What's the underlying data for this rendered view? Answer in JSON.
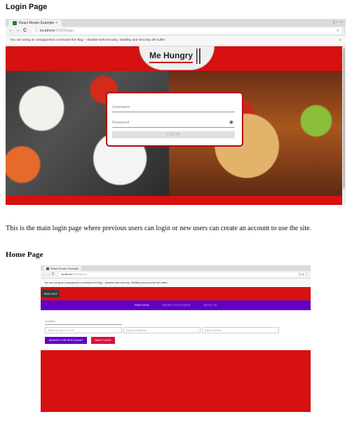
{
  "section1": {
    "heading": "Login Page",
    "description": "This is the main login page where previous users can login or new users can create an account to use the site."
  },
  "section2": {
    "heading": "Home Page"
  },
  "shot1": {
    "tab_title": "React Router Example",
    "tab_close": "×",
    "url_host": "localhost",
    "url_path": ":5000/login",
    "nav_back": "←",
    "nav_forward": "→",
    "nav_reload": "C",
    "lock_glyph": "ⓘ",
    "star_glyph": "☆",
    "menu_glyph": "⋮",
    "window_controls": "▯ – ▫ ×",
    "infobar_message": "You are using an unsupported command-line flag: --disable-web-security. Stability and security will suffer.",
    "infobar_close": "×",
    "logo_text": "Me Hungry",
    "username_placeholder": "Username",
    "password_placeholder": "Password",
    "eye_glyph": "◉",
    "login_button": "LOG IN",
    "colors": {
      "brand_red": "#d71010",
      "card_border": "#b40c0c"
    }
  },
  "shot2": {
    "tab_title": "React Router Example",
    "url_host": "localhost",
    "url_path": ":3000/home",
    "nav_glyphs": "← → C",
    "toolbar_glyphs": "☆ ◐ ⋮",
    "infobar_message": "You are using an unsupported command-line flag: --disable-web-security. Stability and security will suffer.",
    "sign_out": "SIGN OUT",
    "nav_tabs": [
      {
        "label": "FIND FOOD",
        "active": true
      },
      {
        "label": "WHERE YOU'VE BEEN",
        "active": false
      },
      {
        "label": "ABOUT US",
        "active": false
      }
    ],
    "location_label": "Location",
    "selects": [
      {
        "placeholder": "Select a Type of Food"
      },
      {
        "placeholder": "Select a Distance"
      },
      {
        "placeholder": "Select a Price"
      }
    ],
    "chevron_glyph": "⌄",
    "search_button": "SEARCH FOR RESTURANT",
    "save_button": "SAVE PLACE",
    "colors": {
      "nav_purple": "#6200c4",
      "save_pink": "#e00d3c"
    }
  }
}
